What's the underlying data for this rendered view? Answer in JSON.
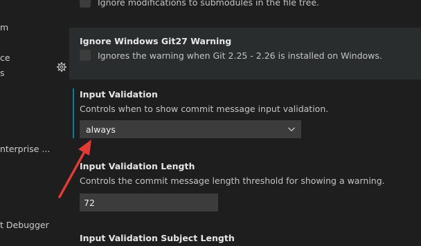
{
  "sidebar": {
    "items": [
      {
        "label": "m"
      },
      {
        "label": "ce"
      },
      {
        "label": "s"
      },
      {
        "label": "nterprise ..."
      },
      {
        "label": "t Debugger"
      }
    ]
  },
  "settings": {
    "ignore_submodules": {
      "checkbox_label": "Ignore modifications to submodules in the file tree."
    },
    "ignore_git27": {
      "title": "Ignore Windows Git27 Warning",
      "checkbox_label": "Ignores the warning when Git 2.25 - 2.26 is installed on Windows."
    },
    "input_validation": {
      "title": "Input Validation",
      "description": "Controls when to show commit message input validation.",
      "selected": "always"
    },
    "input_validation_length": {
      "title": "Input Validation Length",
      "description": "Controls the commit message length threshold for showing a warning.",
      "value": "72"
    },
    "input_validation_subject_length": {
      "title": "Input Validation Subject Length"
    }
  },
  "annotation": {
    "color": "#e53935"
  }
}
